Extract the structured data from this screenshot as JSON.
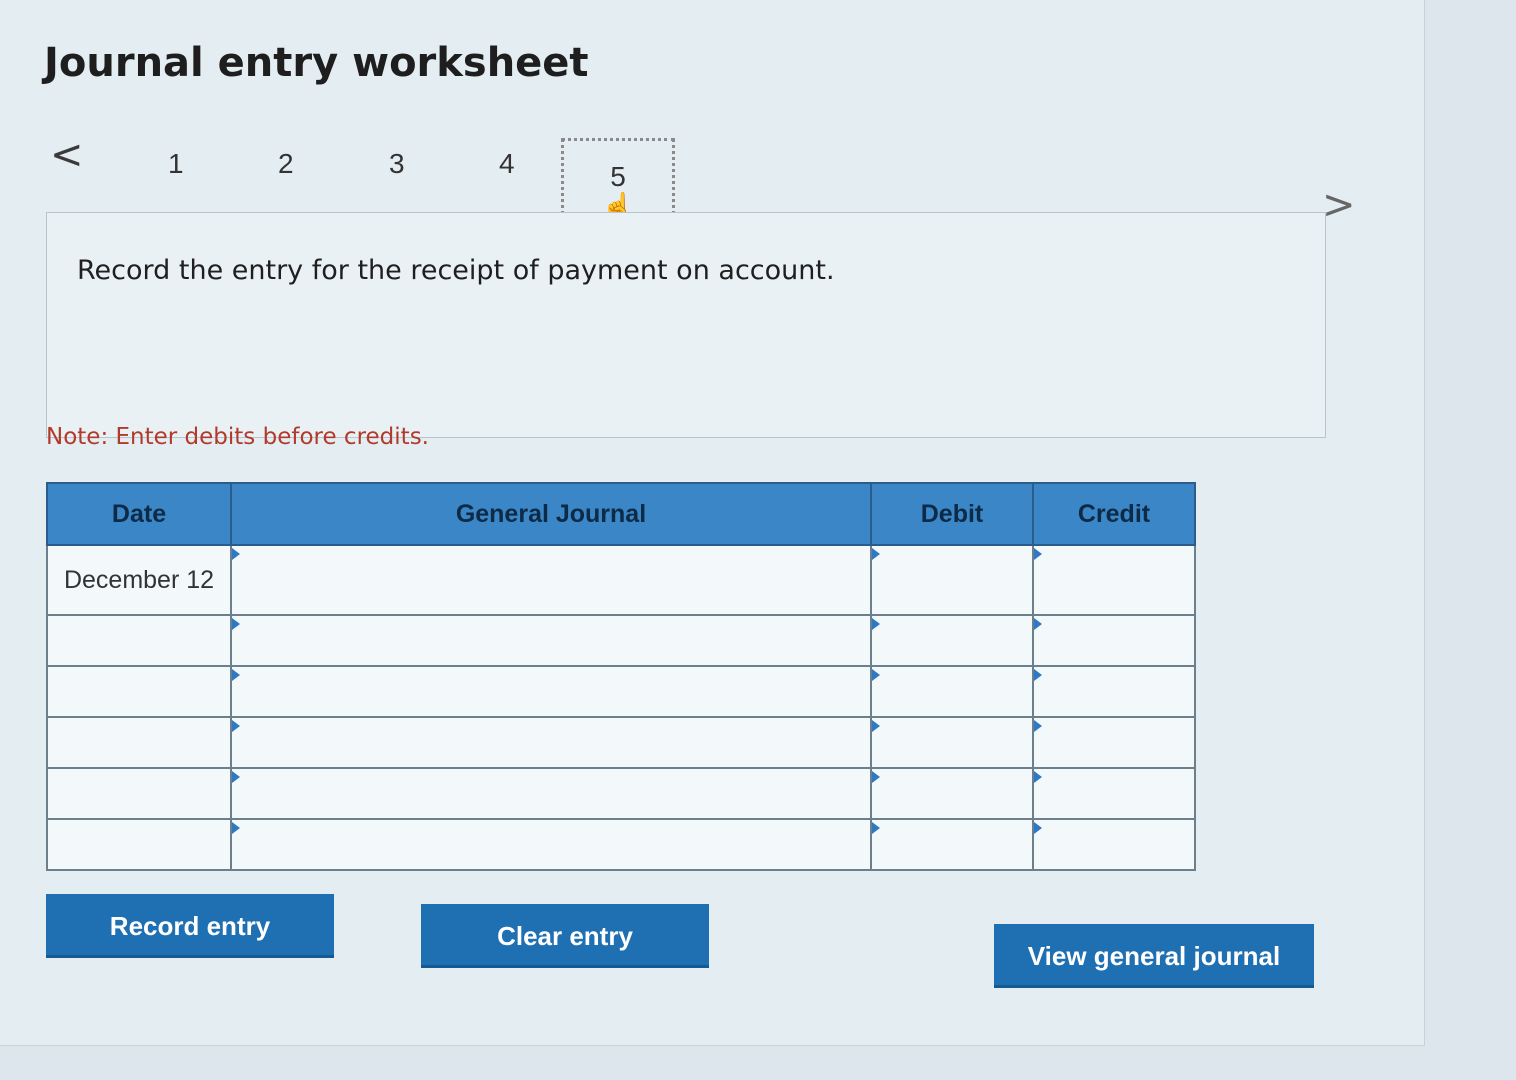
{
  "worksheet": {
    "title": "Journal entry worksheet",
    "steps": [
      "1",
      "2",
      "3",
      "4",
      "5"
    ],
    "active_step": "5",
    "prev_glyph": "<",
    "next_glyph": ">",
    "question": "Record the entry for the receipt of payment on account.",
    "note": "Note: Enter debits before credits."
  },
  "table": {
    "headers": {
      "date": "Date",
      "journal": "General Journal",
      "debit": "Debit",
      "credit": "Credit"
    },
    "rows": [
      {
        "date": "December 12"
      },
      {
        "date": ""
      },
      {
        "date": ""
      },
      {
        "date": ""
      },
      {
        "date": ""
      },
      {
        "date": ""
      }
    ]
  },
  "buttons": {
    "record": "Record entry",
    "clear": "Clear entry",
    "view": "View general journal"
  },
  "icons": {
    "prev": "chevron-left-icon",
    "next": "chevron-right-icon",
    "cursor": "hand-pointer-icon"
  },
  "colors": {
    "header": "#3a86c6",
    "button": "#1f6fb3",
    "note": "#b23a2a"
  }
}
